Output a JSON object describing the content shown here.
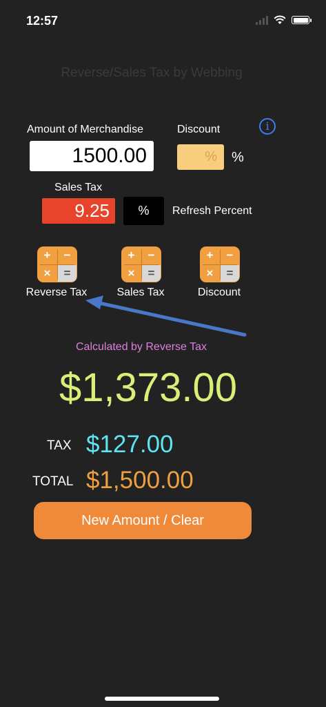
{
  "status_bar": {
    "time": "12:57"
  },
  "app": {
    "title": "Reverse/Sales Tax by Webbing"
  },
  "inputs": {
    "amount_label": "Amount of Merchandise",
    "amount_value": "1500.00",
    "discount_label": "Discount",
    "discount_placeholder": "%",
    "discount_suffix": "%",
    "sales_tax_label": "Sales Tax",
    "sales_tax_value": "9.25",
    "percent_button": "%",
    "refresh_label": "Refresh Percent"
  },
  "info_icon": "i",
  "calculators": [
    {
      "label": "Reverse Tax",
      "icon": "calculator-icon"
    },
    {
      "label": "Sales Tax",
      "icon": "calculator-icon"
    },
    {
      "label": "Discount",
      "icon": "calculator-icon"
    }
  ],
  "calc_symbols": {
    "plus": "+",
    "minus": "−",
    "times": "×",
    "equals": "="
  },
  "result": {
    "calculated_by": "Calculated by Reverse Tax",
    "amount": "$1,373.00",
    "tax_label": "TAX",
    "tax_value": "$127.00",
    "total_label": "TOTAL",
    "total_value": "$1,500.00"
  },
  "actions": {
    "clear_label": "New Amount / Clear"
  },
  "colors": {
    "background": "#222222",
    "result_green": "#d8f078",
    "tax_cyan": "#5ce6f2",
    "total_orange": "#f0a040",
    "sales_tax_red": "#e8432b",
    "annotation_arrow": "#4a78c8"
  }
}
